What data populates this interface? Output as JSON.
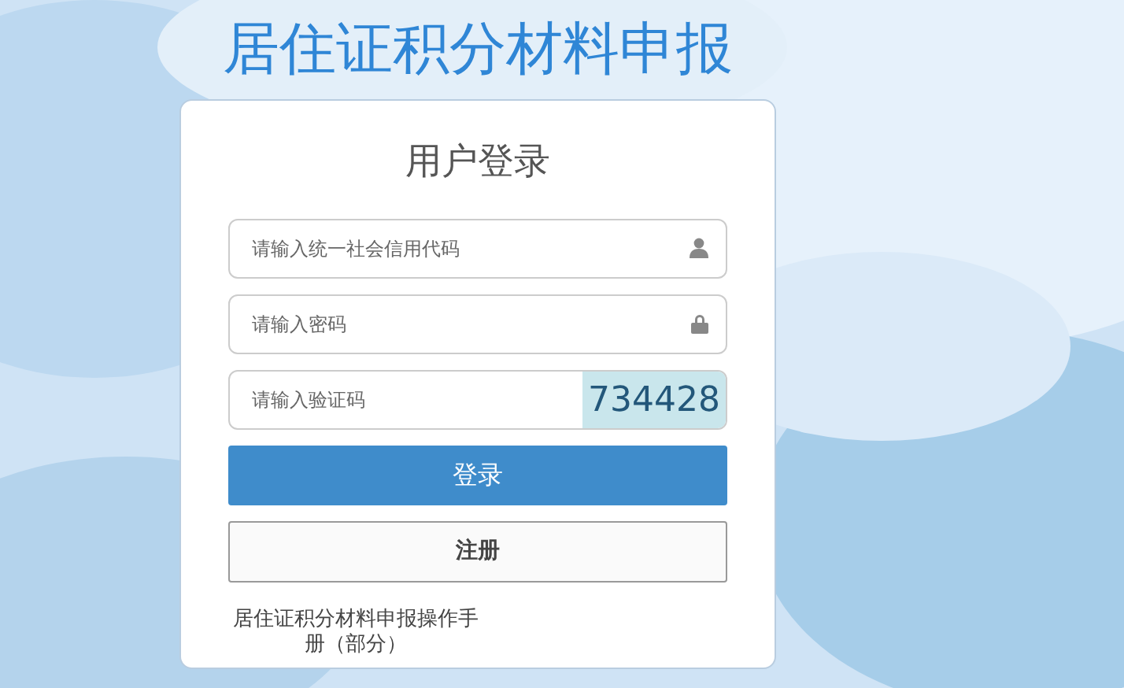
{
  "page_title": "居住证积分材料申报",
  "login_card": {
    "heading": "用户登录",
    "fields": [
      {
        "kind": "user",
        "placeholder": "请输入统一社会信用代码"
      },
      {
        "kind": "password",
        "placeholder": "请输入密码"
      },
      {
        "kind": "captcha",
        "placeholder": "请输入验证码",
        "captcha_code": "734428"
      }
    ],
    "buttons": [
      {
        "kind": "primary",
        "label": "登录"
      },
      {
        "kind": "secondary",
        "label": "注册"
      }
    ],
    "manual_link": "居住证积分材料申报操作手册（部分）"
  }
}
